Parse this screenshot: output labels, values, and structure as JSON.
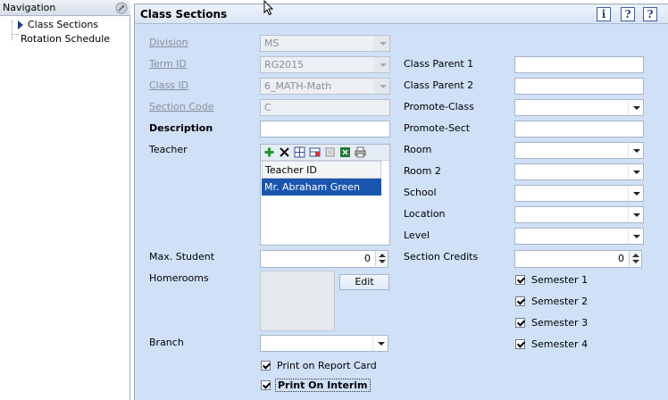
{
  "navigation": {
    "title": "Navigation",
    "items": [
      {
        "label": "Class Sections",
        "selected": true
      },
      {
        "label": "Rotation Schedule",
        "selected": false
      }
    ]
  },
  "header": {
    "title": "Class Sections",
    "icons": [
      "info-icon",
      "help-icon",
      "question-icon"
    ]
  },
  "left_form": {
    "division": {
      "label": "Division",
      "value": "MS"
    },
    "term_id": {
      "label": "Term ID",
      "value": "RG2015"
    },
    "class_id": {
      "label": "Class ID",
      "value": "6_MATH-Math"
    },
    "section_code": {
      "label": "Section Code",
      "value": "C"
    },
    "description": {
      "label": "Description",
      "value": ""
    },
    "teacher": {
      "label": "Teacher",
      "column_header": "Teacher ID",
      "rows": [
        "Mr. Abraham Green"
      ]
    },
    "max_student": {
      "label": "Max. Student",
      "value": "0"
    },
    "homerooms": {
      "label": "Homerooms",
      "edit_label": "Edit"
    },
    "branch": {
      "label": "Branch",
      "value": ""
    },
    "print_on_report_card": {
      "label": "Print on Report Card",
      "checked": true
    },
    "print_on_interim": {
      "label": "Print On Interim",
      "checked": true
    }
  },
  "right_form": {
    "class_parent_1": {
      "label": "Class Parent 1",
      "value": ""
    },
    "class_parent_2": {
      "label": "Class Parent 2",
      "value": ""
    },
    "promote_class": {
      "label": "Promote-Class",
      "value": ""
    },
    "promote_sect": {
      "label": "Promote-Sect",
      "value": ""
    },
    "room": {
      "label": "Room",
      "value": ""
    },
    "room_2": {
      "label": "Room 2",
      "value": ""
    },
    "school": {
      "label": "School",
      "value": ""
    },
    "location": {
      "label": "Location",
      "value": ""
    },
    "level": {
      "label": "Level",
      "value": ""
    },
    "section_credits": {
      "label": "Section Credits",
      "value": "0"
    },
    "semesters": [
      {
        "label": "Semester 1",
        "checked": true
      },
      {
        "label": "Semester 2",
        "checked": true
      },
      {
        "label": "Semester 3",
        "checked": true
      },
      {
        "label": "Semester 4",
        "checked": true
      }
    ]
  },
  "colors": {
    "panel_bg": "#cfe0f7",
    "selection": "#1a56b0",
    "readonly_text": "#8a8f99"
  }
}
